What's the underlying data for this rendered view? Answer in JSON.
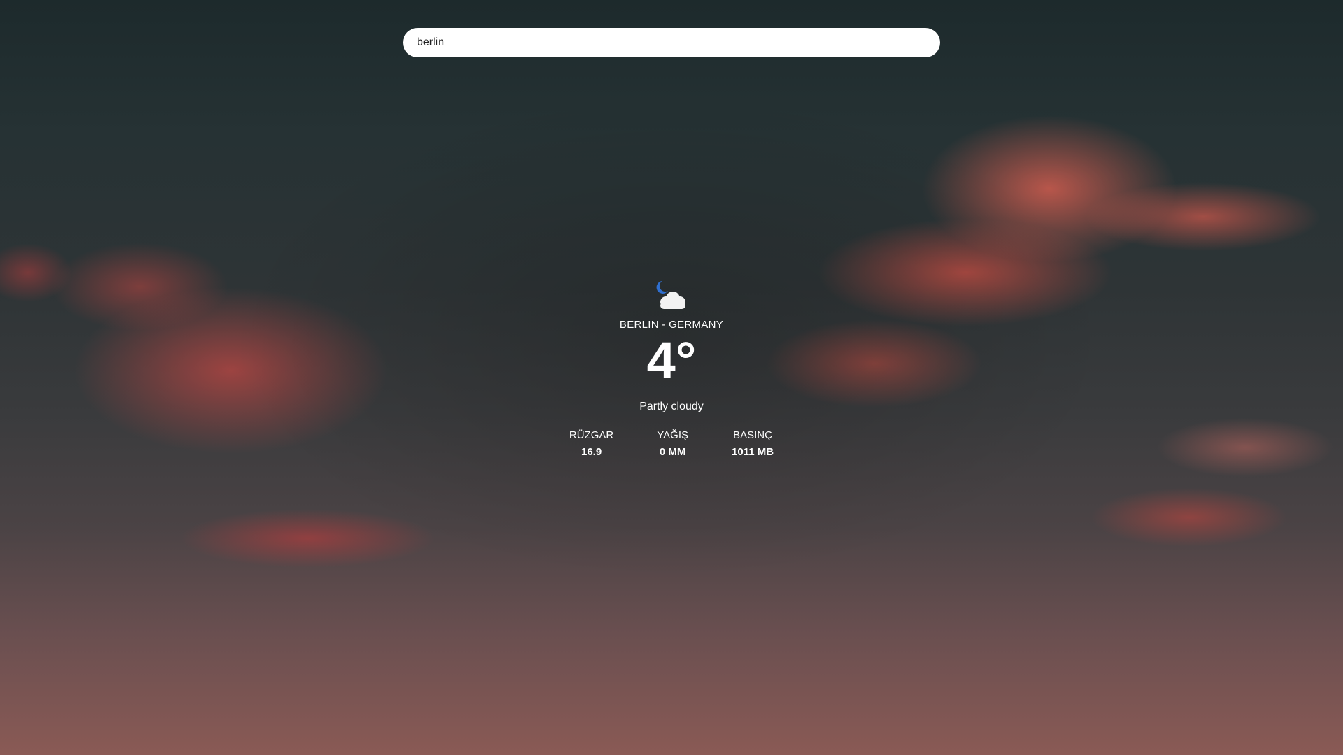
{
  "search": {
    "value": "berlin"
  },
  "weather": {
    "icon": "partly-cloudy-night-icon",
    "location": "BERLIN - GERMANY",
    "temperature": "4°",
    "condition": "Partly cloudy",
    "stats": [
      {
        "label": "RÜZGAR",
        "value": "16.9"
      },
      {
        "label": "YAĞIŞ",
        "value": "0 MM"
      },
      {
        "label": "BASINÇ",
        "value": "1011 MB"
      }
    ]
  },
  "colors": {
    "icon_moon": "#2f6fd0",
    "icon_cloud": "#f2f2f2",
    "text": "#ffffff"
  }
}
